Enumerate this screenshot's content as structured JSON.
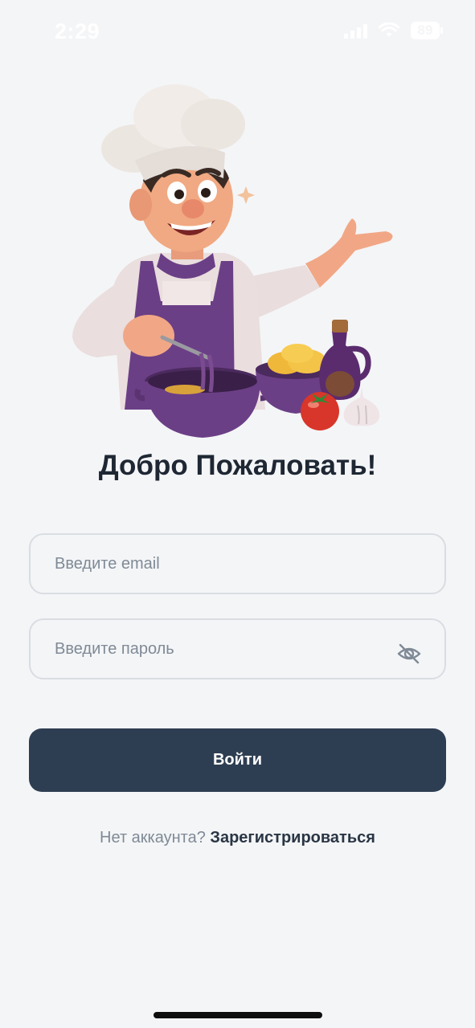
{
  "status_bar": {
    "time": "2:29",
    "battery": "89",
    "icons": [
      "signal-icon",
      "wifi-icon",
      "battery-icon"
    ]
  },
  "hero": {
    "illustration": "chef-cooking-illustration"
  },
  "title": "Добро Пожаловать!",
  "form": {
    "email_placeholder": "Введите email",
    "password_placeholder": "Введите пароль",
    "password_toggle_icon": "eye-off-icon"
  },
  "login_button": "Войти",
  "signup": {
    "prompt": "Нет аккаунта?",
    "link": "Зарегистрироваться"
  },
  "colors": {
    "background": "#f4f5f7",
    "primary_button": "#2e3e52",
    "title_text": "#1e2733",
    "placeholder_text": "#7f8a96",
    "apron_purple": "#6b3f86"
  }
}
